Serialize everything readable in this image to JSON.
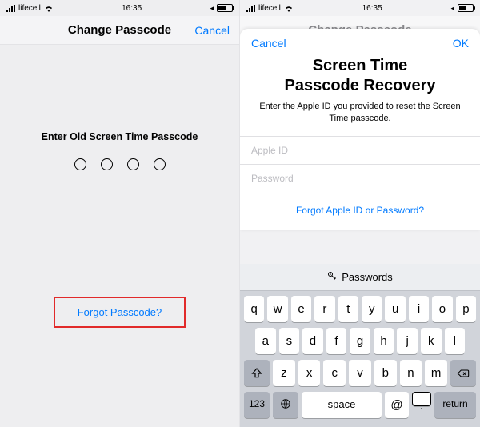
{
  "status": {
    "carrier": "lifecell",
    "time": "16:35",
    "locationGlyph": "◂"
  },
  "leftScreen": {
    "navTitle": "Change Passcode",
    "navCancel": "Cancel",
    "prompt": "Enter Old Screen Time Passcode",
    "forgot": "Forgot Passcode?"
  },
  "rightScreen": {
    "navTitleGhost": "Change Passcode",
    "sheet": {
      "cancel": "Cancel",
      "ok": "OK",
      "title1": "Screen Time",
      "title2": "Passcode Recovery",
      "subtitle": "Enter the Apple ID you provided to reset the Screen Time passcode.",
      "appleIdPlaceholder": "Apple ID",
      "passwordPlaceholder": "Password",
      "forgot": "Forgot Apple ID or Password?"
    }
  },
  "keyboard": {
    "suggestion": "Passwords",
    "row1": [
      "q",
      "w",
      "e",
      "r",
      "t",
      "y",
      "u",
      "i",
      "o",
      "p"
    ],
    "row2": [
      "a",
      "s",
      "d",
      "f",
      "g",
      "h",
      "j",
      "k",
      "l"
    ],
    "row3": [
      "z",
      "x",
      "c",
      "v",
      "b",
      "n",
      "m"
    ],
    "numKey": "123",
    "space": "space",
    "at": "@",
    "dot": ".",
    "ret": "return"
  }
}
